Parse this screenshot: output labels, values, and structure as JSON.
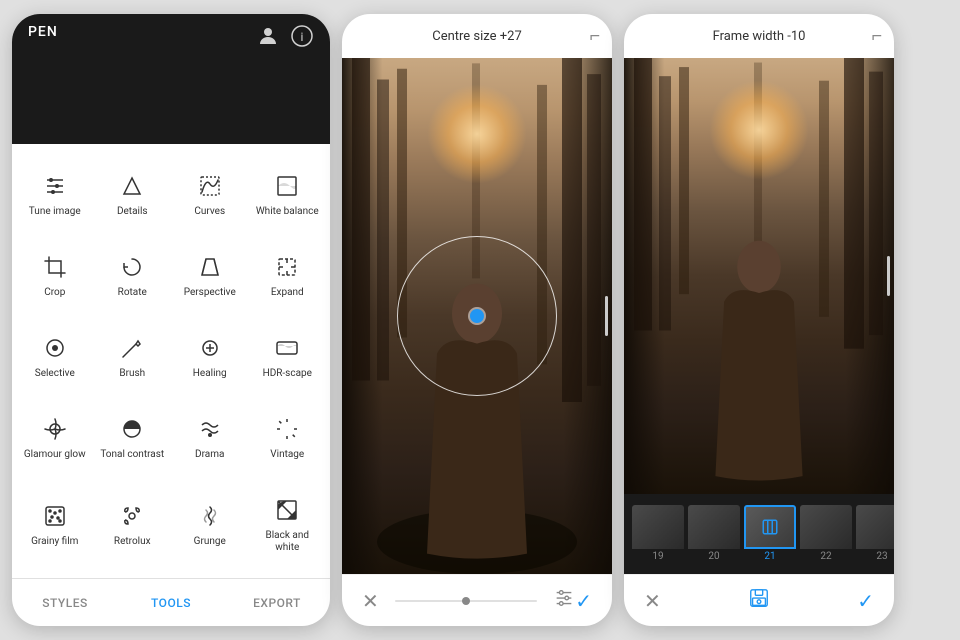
{
  "left_panel": {
    "top_label": "PEN",
    "tools": [
      {
        "id": "tune",
        "label": "Tune image",
        "icon": "sliders"
      },
      {
        "id": "details",
        "label": "Details",
        "icon": "triangle"
      },
      {
        "id": "curves",
        "label": "Curves",
        "icon": "curves"
      },
      {
        "id": "white_balance",
        "label": "White balance",
        "icon": "wb"
      },
      {
        "id": "crop",
        "label": "Crop",
        "icon": "crop"
      },
      {
        "id": "rotate",
        "label": "Rotate",
        "icon": "rotate"
      },
      {
        "id": "perspective",
        "label": "Perspective",
        "icon": "perspective"
      },
      {
        "id": "expand",
        "label": "Expand",
        "icon": "expand"
      },
      {
        "id": "selective",
        "label": "Selective",
        "icon": "selective"
      },
      {
        "id": "brush",
        "label": "Brush",
        "icon": "brush"
      },
      {
        "id": "healing",
        "label": "Healing",
        "icon": "healing"
      },
      {
        "id": "hdrscape",
        "label": "HDR-scape",
        "icon": "hdr"
      },
      {
        "id": "glamour",
        "label": "Glamour glow",
        "icon": "glamour"
      },
      {
        "id": "tonal",
        "label": "Tonal contrast",
        "icon": "tonal"
      },
      {
        "id": "drama",
        "label": "Drama",
        "icon": "drama"
      },
      {
        "id": "vintage",
        "label": "Vintage",
        "icon": "vintage"
      },
      {
        "id": "grainy",
        "label": "Grainy film",
        "icon": "grainy"
      },
      {
        "id": "retrolux",
        "label": "Retrolux",
        "icon": "retrolux"
      },
      {
        "id": "grunge",
        "label": "Grunge",
        "icon": "grunge"
      },
      {
        "id": "blackwhite",
        "label": "Black and white",
        "icon": "bw"
      }
    ],
    "bottom_nav": [
      {
        "id": "styles",
        "label": "STYLES",
        "active": false
      },
      {
        "id": "tools",
        "label": "TOOLS",
        "active": true
      },
      {
        "id": "export",
        "label": "EXPORT",
        "active": false
      }
    ]
  },
  "middle_panel": {
    "header": "Centre size +27",
    "cancel_icon": "✕",
    "adjust_icon": "⚙",
    "confirm_icon": "✓"
  },
  "right_panel": {
    "header": "Frame width -10",
    "film_frames": [
      {
        "num": "19",
        "selected": false
      },
      {
        "num": "20",
        "selected": false
      },
      {
        "num": "21",
        "selected": true
      },
      {
        "num": "22",
        "selected": false
      },
      {
        "num": "23",
        "selected": false
      }
    ],
    "cancel_icon": "✕",
    "save_icon": "💾",
    "confirm_icon": "✓"
  }
}
